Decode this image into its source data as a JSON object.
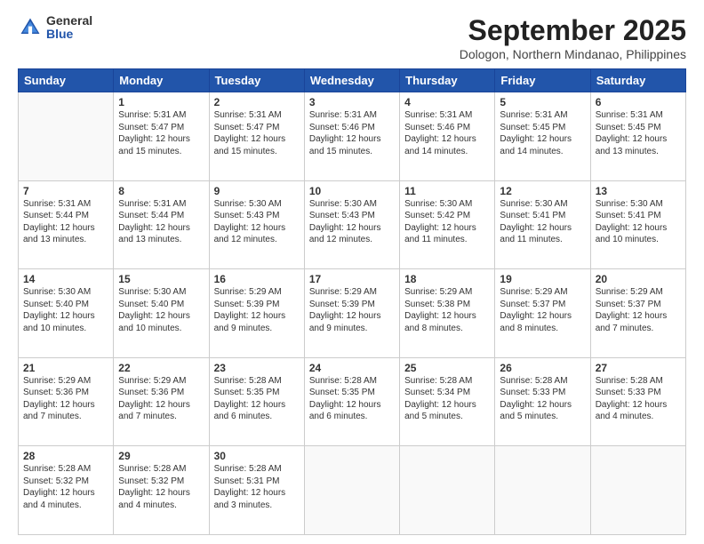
{
  "header": {
    "logo": {
      "general": "General",
      "blue": "Blue"
    },
    "title": "September 2025",
    "subtitle": "Dologon, Northern Mindanao, Philippines"
  },
  "calendar": {
    "days_of_week": [
      "Sunday",
      "Monday",
      "Tuesday",
      "Wednesday",
      "Thursday",
      "Friday",
      "Saturday"
    ],
    "weeks": [
      [
        {
          "day": "",
          "info": ""
        },
        {
          "day": "1",
          "info": "Sunrise: 5:31 AM\nSunset: 5:47 PM\nDaylight: 12 hours\nand 15 minutes."
        },
        {
          "day": "2",
          "info": "Sunrise: 5:31 AM\nSunset: 5:47 PM\nDaylight: 12 hours\nand 15 minutes."
        },
        {
          "day": "3",
          "info": "Sunrise: 5:31 AM\nSunset: 5:46 PM\nDaylight: 12 hours\nand 15 minutes."
        },
        {
          "day": "4",
          "info": "Sunrise: 5:31 AM\nSunset: 5:46 PM\nDaylight: 12 hours\nand 14 minutes."
        },
        {
          "day": "5",
          "info": "Sunrise: 5:31 AM\nSunset: 5:45 PM\nDaylight: 12 hours\nand 14 minutes."
        },
        {
          "day": "6",
          "info": "Sunrise: 5:31 AM\nSunset: 5:45 PM\nDaylight: 12 hours\nand 13 minutes."
        }
      ],
      [
        {
          "day": "7",
          "info": "Sunrise: 5:31 AM\nSunset: 5:44 PM\nDaylight: 12 hours\nand 13 minutes."
        },
        {
          "day": "8",
          "info": "Sunrise: 5:31 AM\nSunset: 5:44 PM\nDaylight: 12 hours\nand 13 minutes."
        },
        {
          "day": "9",
          "info": "Sunrise: 5:30 AM\nSunset: 5:43 PM\nDaylight: 12 hours\nand 12 minutes."
        },
        {
          "day": "10",
          "info": "Sunrise: 5:30 AM\nSunset: 5:43 PM\nDaylight: 12 hours\nand 12 minutes."
        },
        {
          "day": "11",
          "info": "Sunrise: 5:30 AM\nSunset: 5:42 PM\nDaylight: 12 hours\nand 11 minutes."
        },
        {
          "day": "12",
          "info": "Sunrise: 5:30 AM\nSunset: 5:41 PM\nDaylight: 12 hours\nand 11 minutes."
        },
        {
          "day": "13",
          "info": "Sunrise: 5:30 AM\nSunset: 5:41 PM\nDaylight: 12 hours\nand 10 minutes."
        }
      ],
      [
        {
          "day": "14",
          "info": "Sunrise: 5:30 AM\nSunset: 5:40 PM\nDaylight: 12 hours\nand 10 minutes."
        },
        {
          "day": "15",
          "info": "Sunrise: 5:30 AM\nSunset: 5:40 PM\nDaylight: 12 hours\nand 10 minutes."
        },
        {
          "day": "16",
          "info": "Sunrise: 5:29 AM\nSunset: 5:39 PM\nDaylight: 12 hours\nand 9 minutes."
        },
        {
          "day": "17",
          "info": "Sunrise: 5:29 AM\nSunset: 5:39 PM\nDaylight: 12 hours\nand 9 minutes."
        },
        {
          "day": "18",
          "info": "Sunrise: 5:29 AM\nSunset: 5:38 PM\nDaylight: 12 hours\nand 8 minutes."
        },
        {
          "day": "19",
          "info": "Sunrise: 5:29 AM\nSunset: 5:37 PM\nDaylight: 12 hours\nand 8 minutes."
        },
        {
          "day": "20",
          "info": "Sunrise: 5:29 AM\nSunset: 5:37 PM\nDaylight: 12 hours\nand 7 minutes."
        }
      ],
      [
        {
          "day": "21",
          "info": "Sunrise: 5:29 AM\nSunset: 5:36 PM\nDaylight: 12 hours\nand 7 minutes."
        },
        {
          "day": "22",
          "info": "Sunrise: 5:29 AM\nSunset: 5:36 PM\nDaylight: 12 hours\nand 7 minutes."
        },
        {
          "day": "23",
          "info": "Sunrise: 5:28 AM\nSunset: 5:35 PM\nDaylight: 12 hours\nand 6 minutes."
        },
        {
          "day": "24",
          "info": "Sunrise: 5:28 AM\nSunset: 5:35 PM\nDaylight: 12 hours\nand 6 minutes."
        },
        {
          "day": "25",
          "info": "Sunrise: 5:28 AM\nSunset: 5:34 PM\nDaylight: 12 hours\nand 5 minutes."
        },
        {
          "day": "26",
          "info": "Sunrise: 5:28 AM\nSunset: 5:33 PM\nDaylight: 12 hours\nand 5 minutes."
        },
        {
          "day": "27",
          "info": "Sunrise: 5:28 AM\nSunset: 5:33 PM\nDaylight: 12 hours\nand 4 minutes."
        }
      ],
      [
        {
          "day": "28",
          "info": "Sunrise: 5:28 AM\nSunset: 5:32 PM\nDaylight: 12 hours\nand 4 minutes."
        },
        {
          "day": "29",
          "info": "Sunrise: 5:28 AM\nSunset: 5:32 PM\nDaylight: 12 hours\nand 4 minutes."
        },
        {
          "day": "30",
          "info": "Sunrise: 5:28 AM\nSunset: 5:31 PM\nDaylight: 12 hours\nand 3 minutes."
        },
        {
          "day": "",
          "info": ""
        },
        {
          "day": "",
          "info": ""
        },
        {
          "day": "",
          "info": ""
        },
        {
          "day": "",
          "info": ""
        }
      ]
    ]
  }
}
